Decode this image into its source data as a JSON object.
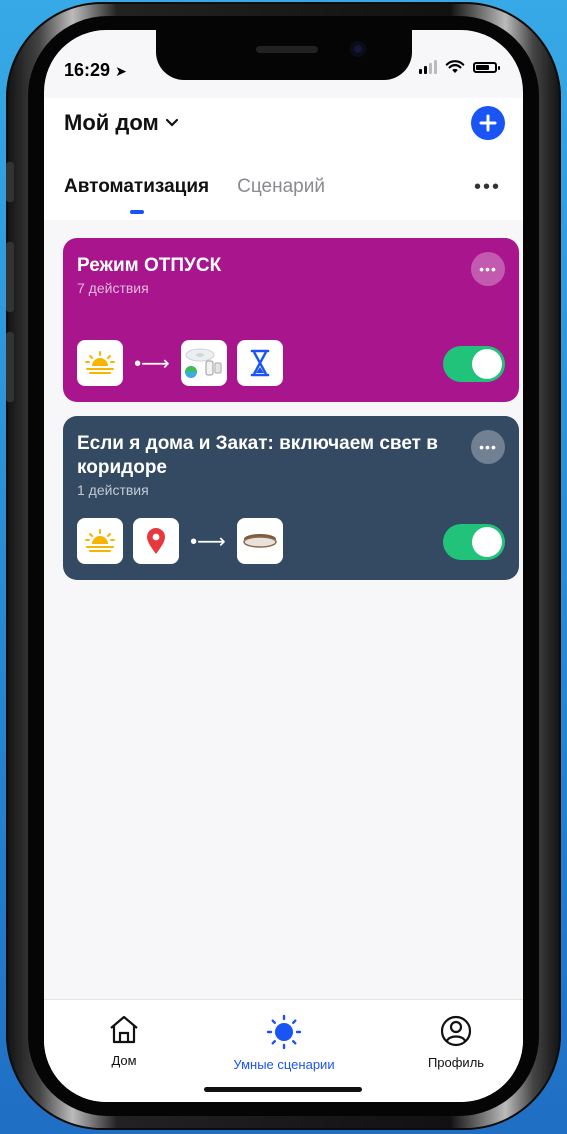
{
  "status_bar": {
    "time": "16:29"
  },
  "header": {
    "home_title": "Мой дом"
  },
  "tabs": [
    {
      "label": "Автоматизация",
      "active": true
    },
    {
      "label": "Сценарий",
      "active": false
    }
  ],
  "automations": [
    {
      "title": "Режим ОТПУСК",
      "subtitle": "7 действия",
      "color": "#a8158d",
      "enabled": true,
      "triggers": [
        "sunset-icon"
      ],
      "actions": [
        "ceiling-lamp-set-icon",
        "hourglass-icon"
      ]
    },
    {
      "title": "Если я дома и Закат: включаем свет в коридоре",
      "subtitle": "1 действия",
      "color": "#344a63",
      "enabled": true,
      "triggers": [
        "sunset-icon",
        "location-pin-icon"
      ],
      "actions": [
        "ceiling-lamp-icon"
      ]
    }
  ],
  "tab_bar": [
    {
      "label": "Дом",
      "icon": "house-icon",
      "active": false
    },
    {
      "label": "Умные сценарии",
      "icon": "sun-icon",
      "active": true
    },
    {
      "label": "Профиль",
      "icon": "profile-icon",
      "active": false
    }
  ],
  "colors": {
    "accent": "#1a54f5",
    "toggle_on": "#21c27a"
  }
}
